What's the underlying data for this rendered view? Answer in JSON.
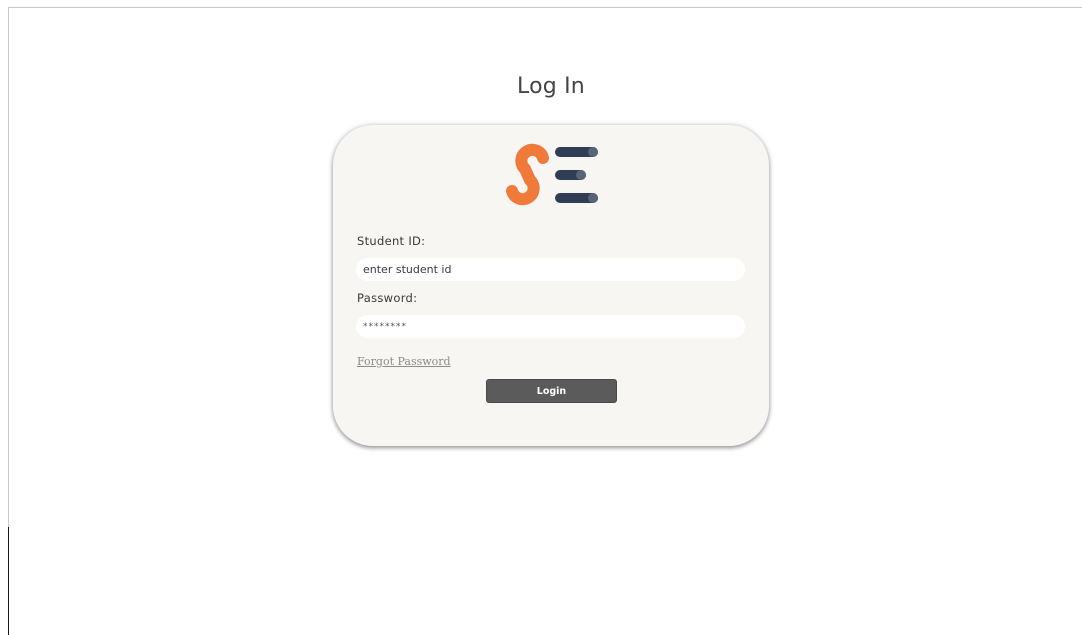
{
  "page": {
    "title": "Log In"
  },
  "logo": {
    "icon": "se-logo-icon",
    "colors": {
      "s": "#f07a3a",
      "bars": "#2f3e55",
      "bar_tips": "#5a6478"
    }
  },
  "form": {
    "student_id_label": "Student ID:",
    "student_id_placeholder": "enter student id",
    "student_id_value": "",
    "password_label": "Password:",
    "password_placeholder": "********",
    "password_value": "",
    "forgot_link": "Forgot Password",
    "login_button": "Login"
  },
  "colors": {
    "card_background": "#f8f6f2",
    "button_background": "#5b5b5b",
    "link_color": "#8b8b8b"
  }
}
